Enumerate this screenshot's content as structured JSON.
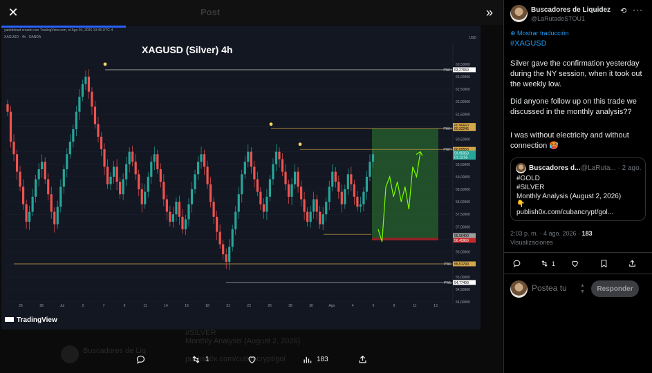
{
  "viewer": {
    "ghost_title": "Post",
    "ghost_reply_name": "Buscadores de Liq",
    "ghost_reply_line1": "#SILVER",
    "ghost_reply_line2": "Monthly Analysis (August 2, 2026)",
    "ghost_reply_line3": "publish0x.com/cubancrypt/gol",
    "actions": {
      "reply": "",
      "repost": "1",
      "like": "",
      "views": "183",
      "share": ""
    }
  },
  "chart": {
    "watermark": "yaolobloud creado con TradingView.com, el Ago 04, 2026 13:46 UTC-4",
    "symbol": "XAGUSD · 4h · OANDA",
    "title": "XAGUSD (Silver) 4h",
    "currency": "USD",
    "brand": "TradingView",
    "price_labels": [
      {
        "text": "63,27650",
        "tag": "PWH"
      },
      {
        "text": "60,95650",
        "tag": ""
      },
      {
        "text": "60,92245",
        "tag": "PWH"
      },
      {
        "text": "60,09550",
        "tag": "PWH"
      },
      {
        "text": "59,95050",
        "tag": ""
      },
      {
        "text": "01:13:55",
        "tag": ""
      },
      {
        "text": "56,56400",
        "tag": ""
      },
      {
        "text": "56,45960",
        "tag": ""
      },
      {
        "text": "55,51790",
        "tag": "PWL"
      },
      {
        "text": "54,77400",
        "tag": "PWL"
      }
    ],
    "y_ticks": [
      "63,50000",
      "63,00000",
      "62,50000",
      "62,00000",
      "61,50000",
      "61,00000",
      "60,50000",
      "60,00000",
      "59,50000",
      "59,00000",
      "58,50000",
      "58,00000",
      "57,50000",
      "57,00000",
      "56,50000",
      "56,00000",
      "55,50000",
      "55,00000",
      "54,50000",
      "54,00000"
    ],
    "x_ticks": [
      "25",
      "28",
      "Jul",
      "2",
      "7",
      "9",
      "11",
      "14",
      "16",
      "18",
      "21",
      "23",
      "26",
      "28",
      "30",
      "Ago",
      "4",
      "6",
      "9",
      "11",
      "13"
    ],
    "colors": {
      "up": "#26a69a",
      "down": "#ef5350",
      "projection": "#7cfc00",
      "zone": "#2e7d32",
      "pwh": "#d4a64a",
      "pwl": "#b0b0b0"
    }
  },
  "chart_data": {
    "type": "candlestick",
    "title": "XAGUSD (Silver) 4h",
    "ylabel": "USD",
    "ylim": [
      54.0,
      63.8
    ],
    "levels": [
      {
        "name": "PWH",
        "value": 63.2765
      },
      {
        "name": "PWH",
        "value": 60.92245
      },
      {
        "name": "PWH",
        "value": 60.0955
      },
      {
        "name": "PWL",
        "value": 55.5179
      },
      {
        "name": "PWL",
        "value": 54.774
      }
    ],
    "last_price": 59.9505,
    "closes": [
      61.6,
      60.4,
      59.9,
      59.2,
      58.6,
      57.9,
      57.2,
      57.6,
      58.2,
      58.9,
      59.3,
      59.6,
      58.9,
      58.3,
      57.6,
      57.1,
      57.8,
      58.6,
      59.3,
      59.9,
      60.4,
      60.9,
      61.6,
      62.2,
      62.7,
      63.0,
      62.4,
      61.8,
      61.1,
      60.6,
      60.1,
      59.4,
      58.7,
      59.0,
      59.4,
      58.8,
      58.3,
      58.9,
      59.5,
      60.0,
      59.6,
      59.1,
      58.5,
      57.9,
      58.4,
      59.0,
      59.6,
      59.9,
      59.3,
      58.8,
      58.1,
      57.6,
      57.2,
      57.5,
      58.0,
      57.4,
      56.9,
      57.3,
      57.9,
      58.5,
      59.1,
      59.6,
      59.9,
      59.4,
      58.7,
      58.0,
      57.4,
      56.8,
      56.3,
      55.9,
      55.6,
      56.2,
      56.9,
      57.6,
      58.3,
      59.1,
      59.6,
      60.0,
      59.4,
      58.9,
      58.4,
      57.9,
      57.6,
      58.2,
      58.9,
      59.5,
      60.0,
      59.7,
      59.2,
      58.7,
      58.2,
      58.7,
      59.2,
      58.6,
      58.1,
      57.6,
      57.2,
      57.6,
      58.1,
      57.6,
      57.1,
      57.5,
      58.0,
      58.6,
      59.2,
      58.8,
      58.4,
      57.9,
      58.5,
      59.1,
      58.7,
      58.2,
      57.8,
      57.9,
      58.4,
      59.0,
      59.6,
      59.9
    ],
    "projection": [
      56.9,
      56.4,
      58.6,
      59.0,
      58.2,
      58.8,
      58.0,
      58.6,
      57.7,
      59.4,
      59.0,
      60.0
    ]
  },
  "panel": {
    "author_name": "Buscadores de Liquidez",
    "author_handle": "@LaRutadeSTOU1",
    "translate": "Mostrar traducción",
    "hashtag": "#XAGUSD",
    "paragraph1": "Silver gave the confirmation yesterday during the NY session, when it took out the weekly low.",
    "paragraph2": "Did anyone follow up on this trade we discussed in the monthly analysis??",
    "paragraph3": "I was without electricity and without connection 🥵",
    "quote": {
      "name": "Buscadores d...",
      "handle": "@LaRuta... · 2 ago.",
      "line1": "#GOLD",
      "line2": "#SILVER",
      "line3": "Monthly Analysis (August 2, 2026)",
      "line4": "👇",
      "line5": "publish0x.com/cubancrypt/gol..."
    },
    "meta_time": "2:03 p. m. · 4 ago. 2026 · ",
    "meta_views": "183",
    "views_label": "Visualizaciones",
    "actions": {
      "reply": "",
      "repost": "1",
      "like": "",
      "bookmark": "",
      "share": ""
    },
    "reply_placeholder": "Postea tu",
    "reply_button": "Responder"
  }
}
